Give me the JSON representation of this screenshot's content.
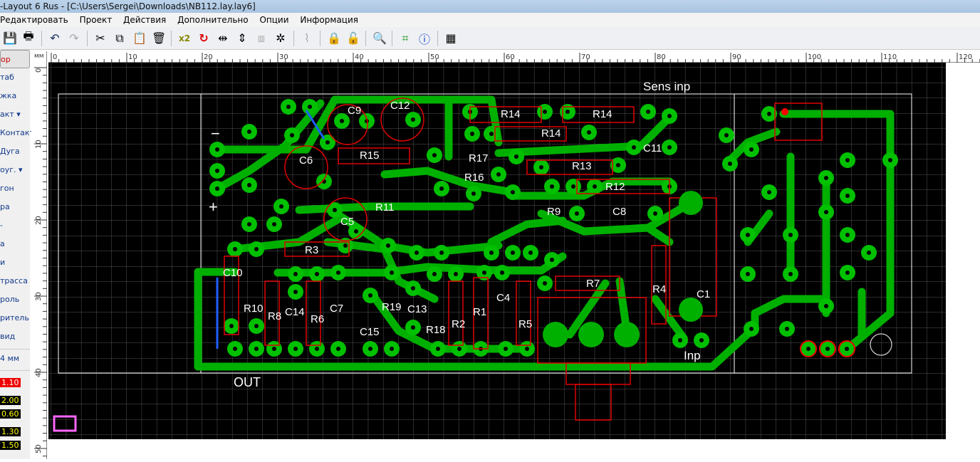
{
  "window": {
    "title": "-Layout 6 Rus - [C:\\Users\\Sergei\\Downloads\\NB112.lay.lay6]"
  },
  "menu": [
    "Редактировать",
    "Проект",
    "Действия",
    "Дополнительно",
    "Опции",
    "Информация"
  ],
  "toolbar": [
    "save-icon",
    "print-icon",
    "undo-icon",
    "redo-icon",
    "cut-icon",
    "copy-icon",
    "paste-icon",
    "delete-icon",
    "x2-icon",
    "rotate-icon",
    "mirror-icon",
    "align-icon",
    "group-icon",
    "snap-icon",
    "route-icon",
    "lock-icon",
    "unlock-icon",
    "zoom-icon",
    "crop-icon",
    "info-icon",
    "pattern-icon"
  ],
  "toolbar_x2": "x2",
  "sidebar": {
    "items": [
      "ор",
      "таб",
      "жка",
      "акт ▾",
      "Контакт",
      "Дуга",
      "оуг. ▾",
      "гон",
      "ра",
      "-",
      "а",
      "и",
      "трасса",
      "роль",
      "ритель",
      "вид"
    ],
    "grid": "4 мм",
    "values": [
      "1.10",
      "2.00",
      "0.60",
      "1.30",
      "1.50"
    ]
  },
  "ruler": {
    "unit": "мм",
    "top": [
      "0",
      "10",
      "20",
      "30",
      "40",
      "50",
      "60",
      "70",
      "80",
      "90",
      "100",
      "110",
      "120"
    ],
    "left": [
      "0",
      "10",
      "20",
      "30",
      "40",
      "50"
    ]
  },
  "board": {
    "labels": [
      {
        "t": "Sens inp"
      },
      {
        "t": "C9"
      },
      {
        "t": "C12"
      },
      {
        "t": "R14"
      },
      {
        "t": "R14"
      },
      {
        "t": "R14"
      },
      {
        "t": "C6"
      },
      {
        "t": "R15"
      },
      {
        "t": "R17"
      },
      {
        "t": "C11"
      },
      {
        "t": "R13"
      },
      {
        "t": "R16"
      },
      {
        "t": "R12"
      },
      {
        "t": "R11"
      },
      {
        "t": "R9"
      },
      {
        "t": "C8"
      },
      {
        "t": "C5"
      },
      {
        "t": "R3"
      },
      {
        "t": "C10"
      },
      {
        "t": "R7"
      },
      {
        "t": "R4"
      },
      {
        "t": "C1"
      },
      {
        "t": "C4"
      },
      {
        "t": "R10"
      },
      {
        "t": "R8"
      },
      {
        "t": "C14"
      },
      {
        "t": "C7"
      },
      {
        "t": "R6"
      },
      {
        "t": "R19"
      },
      {
        "t": "C13"
      },
      {
        "t": "R1"
      },
      {
        "t": "C15"
      },
      {
        "t": "R18"
      },
      {
        "t": "R2"
      },
      {
        "t": "R5"
      },
      {
        "t": "Inp"
      },
      {
        "t": "OUT"
      },
      {
        "t": "−"
      },
      {
        "t": "+"
      }
    ]
  },
  "colors": {
    "trace": "#00b000",
    "pad": "#00c000",
    "outline": "#e00000",
    "grid": "#555555",
    "bg": "#000000"
  }
}
